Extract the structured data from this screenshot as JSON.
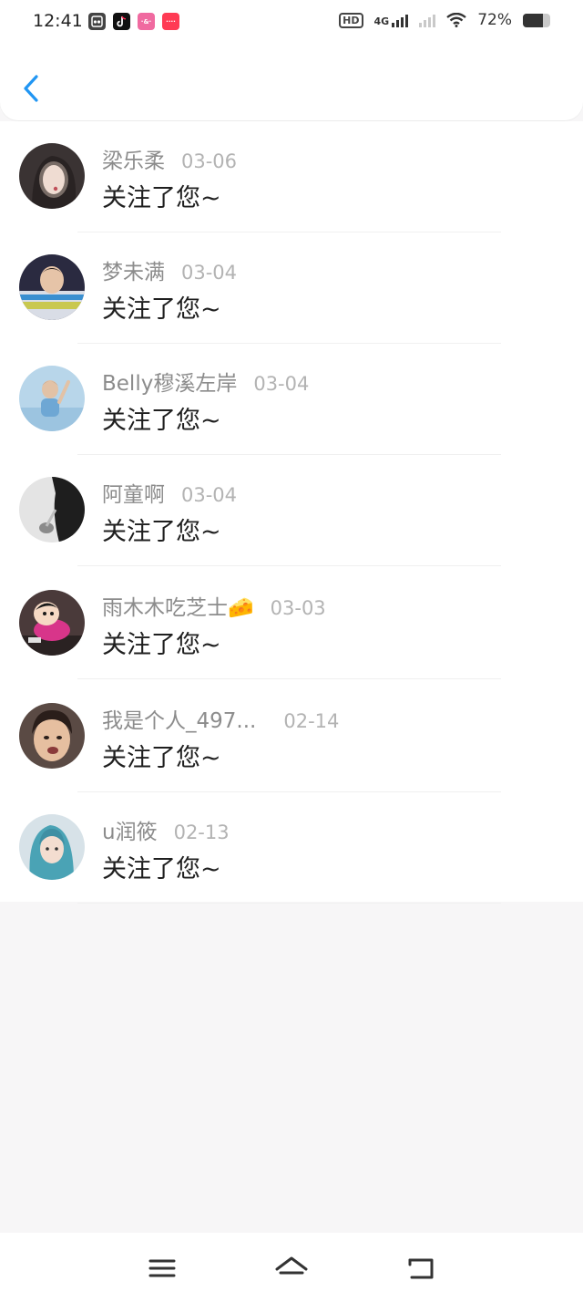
{
  "status_bar": {
    "time": "12:41",
    "notification_icons": [
      "gallery-icon",
      "tiktok-icon",
      "app-icon",
      "app-icon"
    ],
    "network": "4G",
    "battery": "72%",
    "battery_level": 0.72
  },
  "header": {
    "back_icon": "chevron-left-icon",
    "accent": "#2196F3"
  },
  "items": [
    {
      "name": "梁乐柔",
      "date": "03-06",
      "message": "关注了您~"
    },
    {
      "name": "梦未满",
      "date": "03-04",
      "message": "关注了您~"
    },
    {
      "name": "Belly穆溪左岸",
      "date": "03-04",
      "message": "关注了您~"
    },
    {
      "name": "阿童啊",
      "date": "03-04",
      "message": "关注了您~"
    },
    {
      "name": "雨木木吃芝士🧀",
      "date": "03-03",
      "message": "关注了您~"
    },
    {
      "name": "我是个人_497...",
      "date": "02-14",
      "message": "关注了您~"
    },
    {
      "name": "u润筱",
      "date": "02-13",
      "message": "关注了您~"
    }
  ],
  "nav": [
    "menu-icon",
    "home-icon",
    "back-icon"
  ]
}
